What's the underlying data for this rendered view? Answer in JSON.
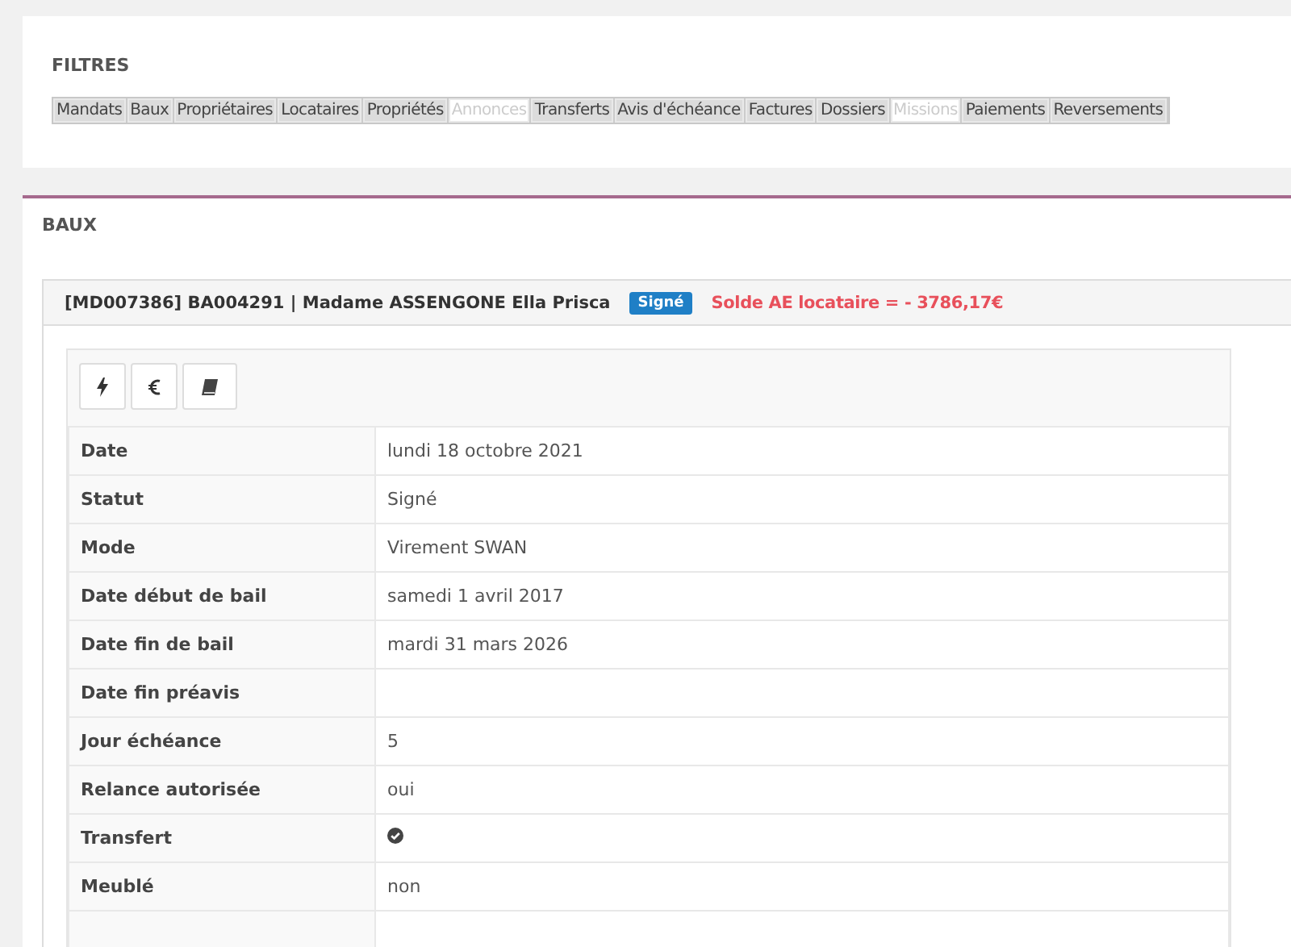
{
  "filters": {
    "title": "FILTRES",
    "tabs": [
      {
        "label": "Mandats",
        "disabled": false
      },
      {
        "label": "Baux",
        "disabled": false
      },
      {
        "label": "Propriétaires",
        "disabled": false
      },
      {
        "label": "Locataires",
        "disabled": false
      },
      {
        "label": "Propriétés",
        "disabled": false
      },
      {
        "label": "Annonces",
        "disabled": true
      },
      {
        "label": "Transferts",
        "disabled": false
      },
      {
        "label": "Avis d'échéance",
        "disabled": false
      },
      {
        "label": "Factures",
        "disabled": false
      },
      {
        "label": "Dossiers",
        "disabled": false
      },
      {
        "label": "Missions",
        "disabled": true
      },
      {
        "label": "Paiements",
        "disabled": false
      },
      {
        "label": "Reversements",
        "disabled": false
      }
    ]
  },
  "section": {
    "title": "BAUX"
  },
  "lease": {
    "heading": "[MD007386] BA004291 | Madame ASSENGONE Ella Prisca",
    "badge": "Signé",
    "balance": "Solde AE locataire = - 3786,17€",
    "actions": [
      {
        "kind": "bolt"
      },
      {
        "kind": "euro"
      },
      {
        "kind": "book"
      }
    ],
    "rows": [
      {
        "label": "Date",
        "kind": "text",
        "value": "lundi 18 octobre 2021"
      },
      {
        "label": "Statut",
        "kind": "text",
        "value": "Signé"
      },
      {
        "label": "Mode",
        "kind": "text",
        "value": "Virement SWAN"
      },
      {
        "label": "Date début de bail",
        "kind": "text",
        "value": "samedi 1 avril 2017"
      },
      {
        "label": "Date fin de bail",
        "kind": "text",
        "value": "mardi 31 mars 2026"
      },
      {
        "label": "Date fin préavis",
        "kind": "empty"
      },
      {
        "label": "Jour échéance",
        "kind": "text",
        "value": "5"
      },
      {
        "label": "Relance autorisée",
        "kind": "text",
        "value": "oui"
      },
      {
        "label": "Transfert",
        "kind": "check",
        "checked": true
      },
      {
        "label": "Meublé",
        "kind": "text",
        "value": "non"
      },
      {
        "kind": "empty"
      }
    ]
  }
}
